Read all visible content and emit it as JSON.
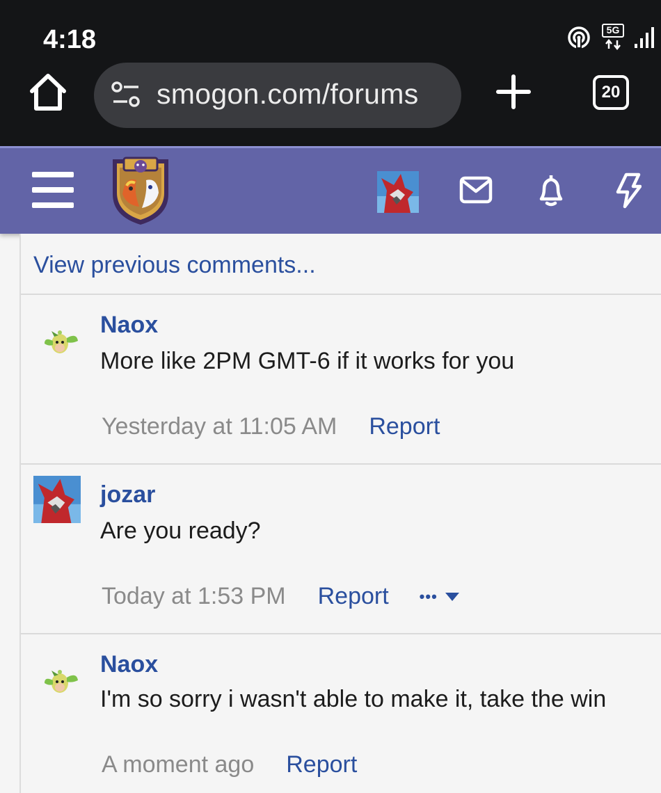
{
  "status_bar": {
    "time": "4:18",
    "network": "5G",
    "icons": [
      "hotspot-icon",
      "5g-icon",
      "signal-icon"
    ]
  },
  "browser": {
    "url": "smogon.com/forums",
    "tab_count": "20",
    "icons": [
      "home-icon",
      "site-settings-icon",
      "new-tab-icon",
      "tab-switcher-icon"
    ]
  },
  "header": {
    "icons": [
      "menu-icon",
      "site-logo",
      "user-avatar",
      "envelope-icon",
      "bell-icon",
      "lightning-icon"
    ],
    "colors": {
      "header_bg": "#6264a7",
      "link": "#2a4f9e"
    }
  },
  "comments": {
    "view_previous": "View previous comments...",
    "items": [
      {
        "user": "Naox",
        "text": "More like 2PM GMT-6 if it works for you",
        "time": "Yesterday at 11:05 AM",
        "report": "Report"
      },
      {
        "user": "jozar",
        "text": "Are you ready?",
        "time": "Today at 1:53 PM",
        "report": "Report",
        "more": "•••"
      },
      {
        "user": "Naox",
        "text": "I'm so sorry i wasn't able to make it, take the win",
        "time": "A moment ago",
        "report": "Report"
      }
    ]
  }
}
